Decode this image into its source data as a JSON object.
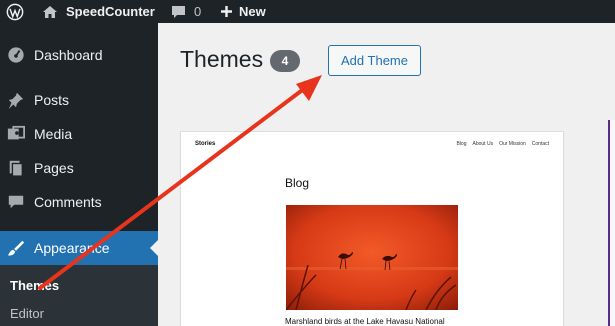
{
  "adminbar": {
    "site_name": "SpeedCounter",
    "comments_count": "0",
    "new_label": "New"
  },
  "sidebar": {
    "items": [
      {
        "label": "Dashboard",
        "icon": "dashboard-icon"
      },
      {
        "label": "Posts",
        "icon": "pin-icon"
      },
      {
        "label": "Media",
        "icon": "media-icon"
      },
      {
        "label": "Pages",
        "icon": "pages-icon"
      },
      {
        "label": "Comments",
        "icon": "comment-icon"
      },
      {
        "label": "Appearance",
        "icon": "brush-icon",
        "active": true
      }
    ],
    "submenu": [
      {
        "label": "Themes",
        "current": true
      },
      {
        "label": "Editor"
      }
    ]
  },
  "main": {
    "title": "Themes",
    "count": "4",
    "add_button": "Add Theme",
    "theme_preview": {
      "site_title": "Stories",
      "nav": [
        "Blog",
        "About Us",
        "Our Mission",
        "Contact"
      ],
      "heading": "Blog",
      "caption": "Marshland birds at the Lake Havasu National"
    }
  },
  "colors": {
    "adminbar_bg": "#1d2327",
    "active_menu": "#2271b1",
    "annotation_arrow": "#e8341c"
  }
}
